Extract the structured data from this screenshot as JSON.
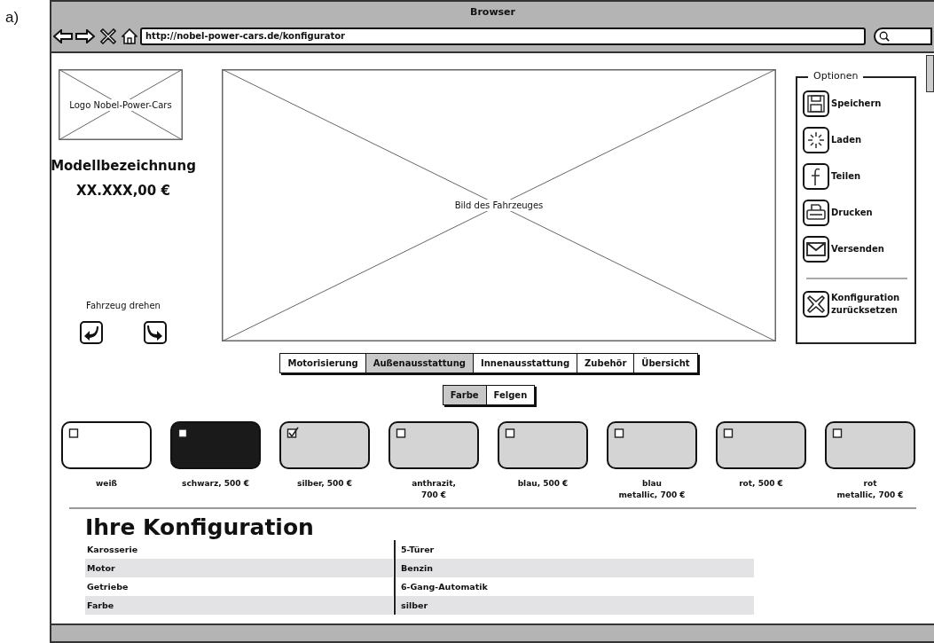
{
  "figure_label": "a)",
  "window": {
    "title": "Browser",
    "url": "http://nobel-power-cars.de/konfigurator"
  },
  "logo": {
    "label": "Logo Nobel-Power-Cars"
  },
  "model": {
    "name": "Modellbezeichnung",
    "price": "XX.XXX,00 €"
  },
  "rotate": {
    "label": "Fahrzeug drehen"
  },
  "vehicle_image": {
    "label": "Bild des Fahrzeuges"
  },
  "options": {
    "title": "Optionen",
    "items": [
      {
        "kind": "save",
        "label": "Speichern"
      },
      {
        "kind": "load",
        "label": "Laden"
      },
      {
        "kind": "share",
        "label": "Teilen"
      },
      {
        "kind": "print",
        "label": "Drucken"
      },
      {
        "kind": "send",
        "label": "Versenden"
      },
      {
        "kind": "reset",
        "label": "Konfiguration zurücksetzen"
      }
    ]
  },
  "tabs": [
    {
      "label": "Motorisierung",
      "selected": false
    },
    {
      "label": "Außenausstattung",
      "selected": true
    },
    {
      "label": "Innenausstattung",
      "selected": false
    },
    {
      "label": "Zubehör",
      "selected": false
    },
    {
      "label": "Übersicht",
      "selected": false
    }
  ],
  "subtabs": [
    {
      "label": "Farbe",
      "selected": true
    },
    {
      "label": "Felgen",
      "selected": false
    }
  ],
  "colors": [
    {
      "label": "weiß",
      "color": "#ffffff",
      "selected": false
    },
    {
      "label": "schwarz, 500 €",
      "color": "#1a1a1a",
      "selected": false
    },
    {
      "label": "silber, 500 €",
      "color": "#d4d4d4",
      "selected": true
    },
    {
      "label": "anthrazit,\n700 €",
      "color": "#d4d4d4",
      "selected": false
    },
    {
      "label": "blau, 500 €",
      "color": "#d4d4d4",
      "selected": false
    },
    {
      "label": "blau\nmetallic, 700 €",
      "color": "#d4d4d4",
      "selected": false
    },
    {
      "label": "rot, 500 €",
      "color": "#d4d4d4",
      "selected": false
    },
    {
      "label": "rot\nmetallic, 700 €",
      "color": "#d4d4d4",
      "selected": false
    }
  ],
  "configuration": {
    "title": "Ihre Konfiguration",
    "rows": [
      {
        "property": "Karosserie",
        "value": "5-Türer"
      },
      {
        "property": "Motor",
        "value": "Benzin"
      },
      {
        "property": "Getriebe",
        "value": "6-Gang-Automatik"
      },
      {
        "property": "Farbe",
        "value": "silber"
      }
    ]
  }
}
